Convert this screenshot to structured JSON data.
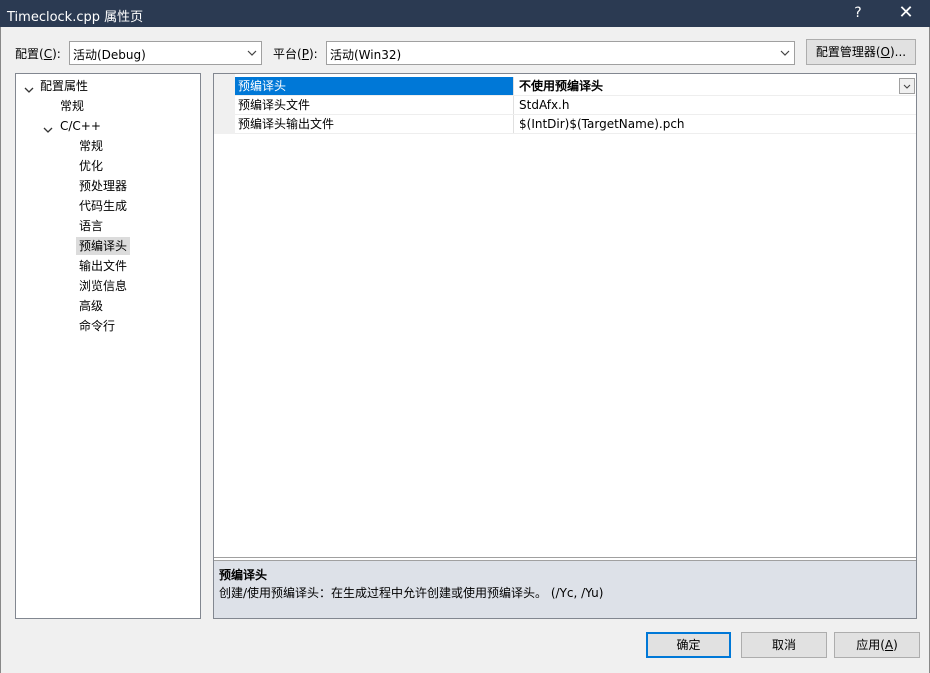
{
  "window": {
    "title": "Timeclock.cpp 属性页",
    "help_glyph": "?",
    "close_glyph": "✕"
  },
  "toolbar": {
    "config_label": "配置(",
    "config_key": "C",
    "config_suffix": "):",
    "config_value": "活动(Debug)",
    "platform_label": "平台(",
    "platform_key": "P",
    "platform_suffix": "):",
    "platform_value": "活动(Win32)",
    "manager_label": "配置管理器(",
    "manager_key": "O",
    "manager_suffix": ")..."
  },
  "tree": {
    "root": "配置属性",
    "general": "常规",
    "cpp": "C/C++",
    "items": [
      "常规",
      "优化",
      "预处理器",
      "代码生成",
      "语言",
      "预编译头",
      "输出文件",
      "浏览信息",
      "高级",
      "命令行"
    ],
    "selected_index": 5
  },
  "grid": {
    "rows": [
      {
        "name": "预编译头",
        "value": "不使用预编译头"
      },
      {
        "name": "预编译头文件",
        "value": "StdAfx.h"
      },
      {
        "name": "预编译头输出文件",
        "value": "$(IntDir)$(TargetName).pch"
      }
    ]
  },
  "description": {
    "title": "预编译头",
    "text": "创建/使用预编译头：在生成过程中允许创建或使用预编译头。     (/Yc, /Yu)"
  },
  "buttons": {
    "ok": "确定",
    "cancel": "取消",
    "apply_label": "应用(",
    "apply_key": "A",
    "apply_suffix": ")"
  },
  "colors": {
    "titlebar": "#2b3a52",
    "selection": "#0078d7",
    "dialog_bg": "#f0f0f0",
    "description_bg": "#dde1e8"
  }
}
